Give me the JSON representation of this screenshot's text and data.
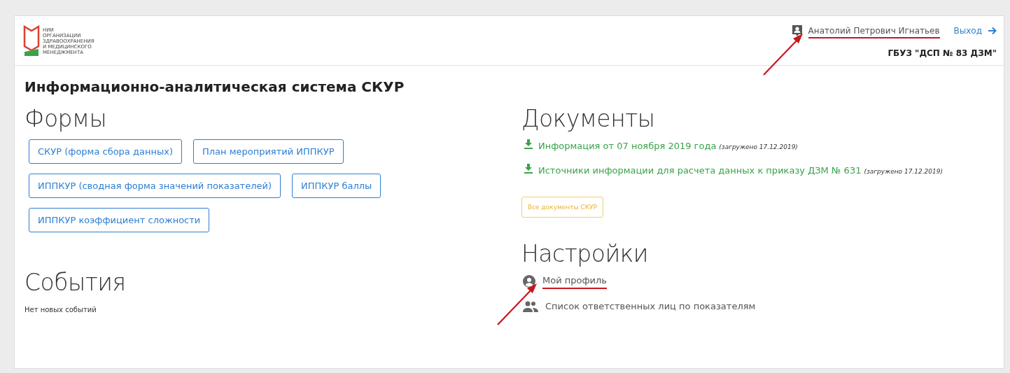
{
  "header": {
    "logo_lines": [
      "НИИ",
      "ОРГАНИЗАЦИИ",
      "ЗДРАВООХРАНЕНИЯ",
      "И МЕДИЦИНСКОГО",
      "МЕНЕДЖМЕНТА"
    ],
    "user": {
      "name": "Анатолий Петрович Игнатьев",
      "annotated": true
    },
    "logout": "Выход",
    "organization": "ГБУЗ \"ДСП № 83 ДЗМ\""
  },
  "title": "Информационно-аналитическая система СКУР",
  "forms": {
    "heading": "Формы",
    "buttons": [
      "СКУР (форма сбора данных)",
      "План мероприятий ИППКУР",
      "ИППКУР (сводная форма значений показателей)",
      "ИППКУР баллы",
      "ИППКУР коэффициент сложности"
    ]
  },
  "events": {
    "heading": "События",
    "message": "Нет новых событий"
  },
  "documents": {
    "heading": "Документы",
    "items": [
      {
        "title": "Информация от 07 ноября 2019 года",
        "note": "(загружено 17.12.2019)"
      },
      {
        "title": "Источники информации для расчета данных к приказу ДЗМ № 631",
        "note": "(загружено 17.12.2019)"
      }
    ],
    "all_button": "Все документы СКУР"
  },
  "settings": {
    "heading": "Настройки",
    "items": [
      {
        "kind": "profile",
        "label": "Мой профиль",
        "annotated": true
      },
      {
        "kind": "people",
        "label": "Список ответственных лиц по показателям",
        "annotated": false
      }
    ]
  }
}
